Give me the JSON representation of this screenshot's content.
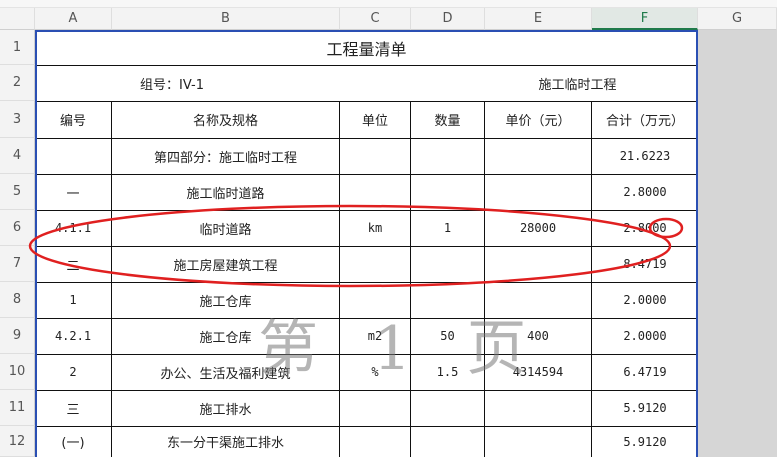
{
  "columns": [
    "A",
    "B",
    "C",
    "D",
    "E",
    "F",
    "G"
  ],
  "rows": [
    "1",
    "2",
    "3",
    "4",
    "5",
    "6",
    "7",
    "8",
    "9",
    "10",
    "11",
    "12"
  ],
  "title": "工程量清单",
  "group_label": "组号：IV-1",
  "project_label": "施工临时工程",
  "headers": {
    "code": "编号",
    "name": "名称及规格",
    "unit": "单位",
    "qty": "数量",
    "price": "单价（元）",
    "total": "合计（万元）"
  },
  "items": [
    {
      "code": "",
      "name": "第四部分：施工临时工程",
      "unit": "",
      "qty": "",
      "price": "",
      "total": "21.6223"
    },
    {
      "code": "一",
      "name": "施工临时道路",
      "unit": "",
      "qty": "",
      "price": "",
      "total": "2.8000"
    },
    {
      "code": "4.1.1",
      "name": "临时道路",
      "unit": "km",
      "qty": "1",
      "price": "28000",
      "total": "2.8000"
    },
    {
      "code": "二",
      "name": "施工房屋建筑工程",
      "unit": "",
      "qty": "",
      "price": "",
      "total": "8.4719"
    },
    {
      "code": "1",
      "name": "施工仓库",
      "unit": "",
      "qty": "",
      "price": "",
      "total": "2.0000"
    },
    {
      "code": "4.2.1",
      "name": "施工仓库",
      "unit": "m2",
      "qty": "50",
      "price": "400",
      "total": "2.0000"
    },
    {
      "code": "2",
      "name": "办公、生活及福利建筑",
      "unit": "%",
      "qty": "1.5",
      "price": "4314594",
      "total": "6.4719"
    },
    {
      "code": "三",
      "name": "施工排水",
      "unit": "",
      "qty": "",
      "price": "",
      "total": "5.9120"
    },
    {
      "code": "(一)",
      "name": "东一分干渠施工排水",
      "unit": "",
      "qty": "",
      "price": "",
      "total": "5.9120"
    }
  ],
  "watermark": "第 1 页",
  "colors": {
    "frame": "#2a4fb3",
    "annotation": "#e02020",
    "active_col": "#1f7a4a"
  }
}
